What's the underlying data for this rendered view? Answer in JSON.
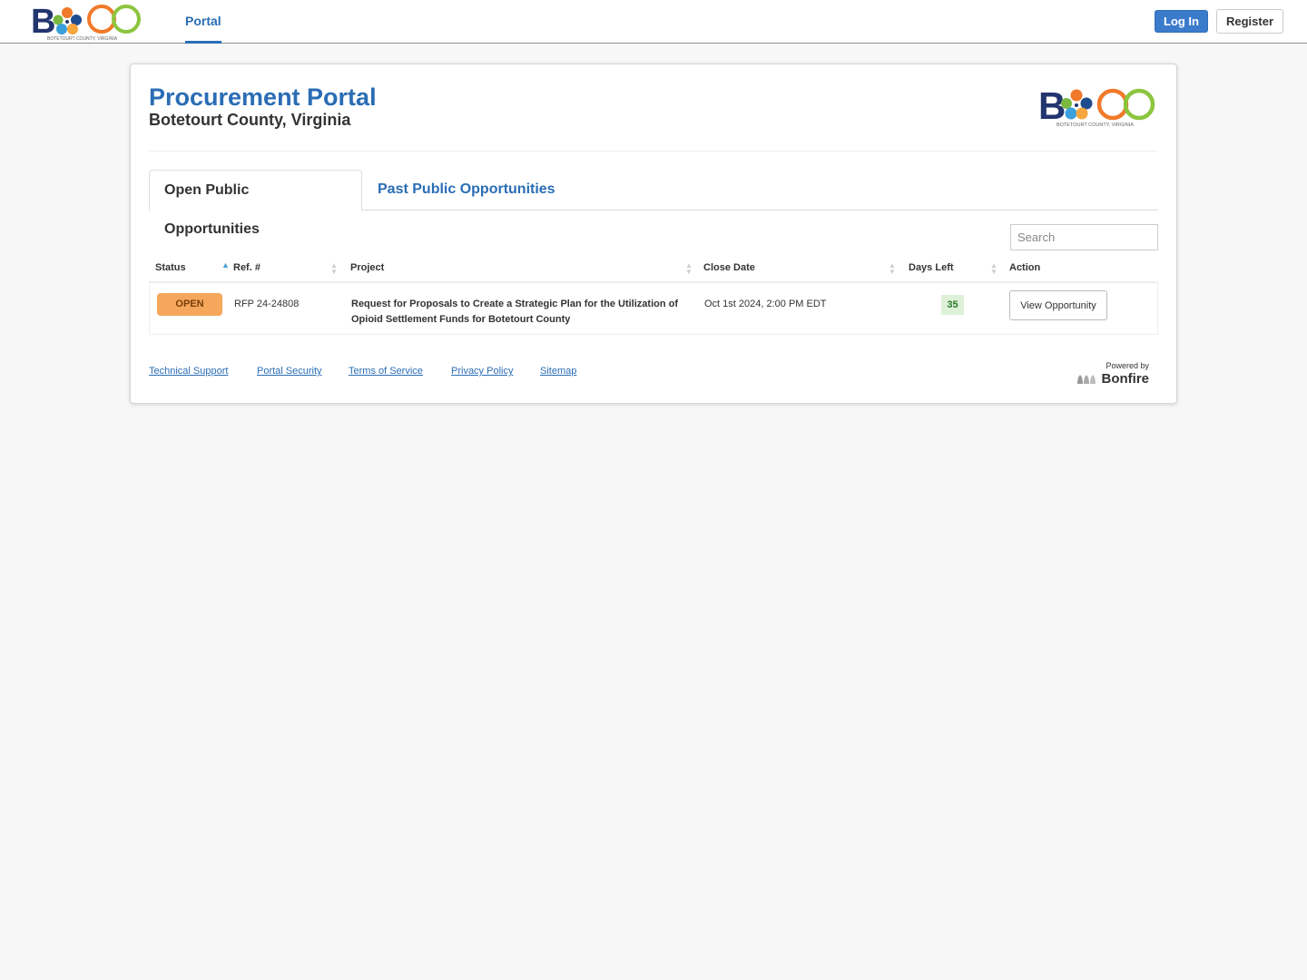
{
  "topnav": {
    "logo_alt": "BoCo Botetourt County, Virginia",
    "portal_label": "Portal",
    "login_label": "Log In",
    "register_label": "Register"
  },
  "header": {
    "title": "Procurement Portal",
    "subtitle": "Botetourt County, Virginia",
    "logo_text": "BOTETOURT COUNTY, VIRGINIA"
  },
  "tabs": [
    {
      "label": "Open Public Opportunities",
      "active": true
    },
    {
      "label": "Past Public Opportunities",
      "active": false
    }
  ],
  "search": {
    "placeholder": "Search",
    "value": ""
  },
  "table": {
    "columns": [
      {
        "label": "Status",
        "sort": "ascending"
      },
      {
        "label": "Ref. #",
        "sort": "none"
      },
      {
        "label": "Project",
        "sort": "none"
      },
      {
        "label": "Close Date",
        "sort": "none"
      },
      {
        "label": "Days Left",
        "sort": "none"
      },
      {
        "label": "Action",
        "sort": "none"
      }
    ],
    "rows": [
      {
        "status": "OPEN",
        "ref": "RFP 24-24808",
        "project": "Request for Proposals to Create a Strategic Plan for the Utilization of Opioid Settlement Funds for Botetourt County",
        "close_date": "Oct 1st 2024, 2:00 PM EDT",
        "days_left": "35",
        "action": "View Opportunity"
      }
    ]
  },
  "footer": {
    "links": [
      "Technical Support",
      "Portal Security",
      "Terms of Service",
      "Privacy Policy",
      "Sitemap"
    ],
    "powered_by": "Powered by",
    "brand": "Bonfire"
  },
  "colors": {
    "primary": "#2a6db5",
    "login_button": "#3a7bcc",
    "status_open": "#f5a75c",
    "days_left_bg": "#dff0d8",
    "days_left_text": "#2b7a2b"
  }
}
